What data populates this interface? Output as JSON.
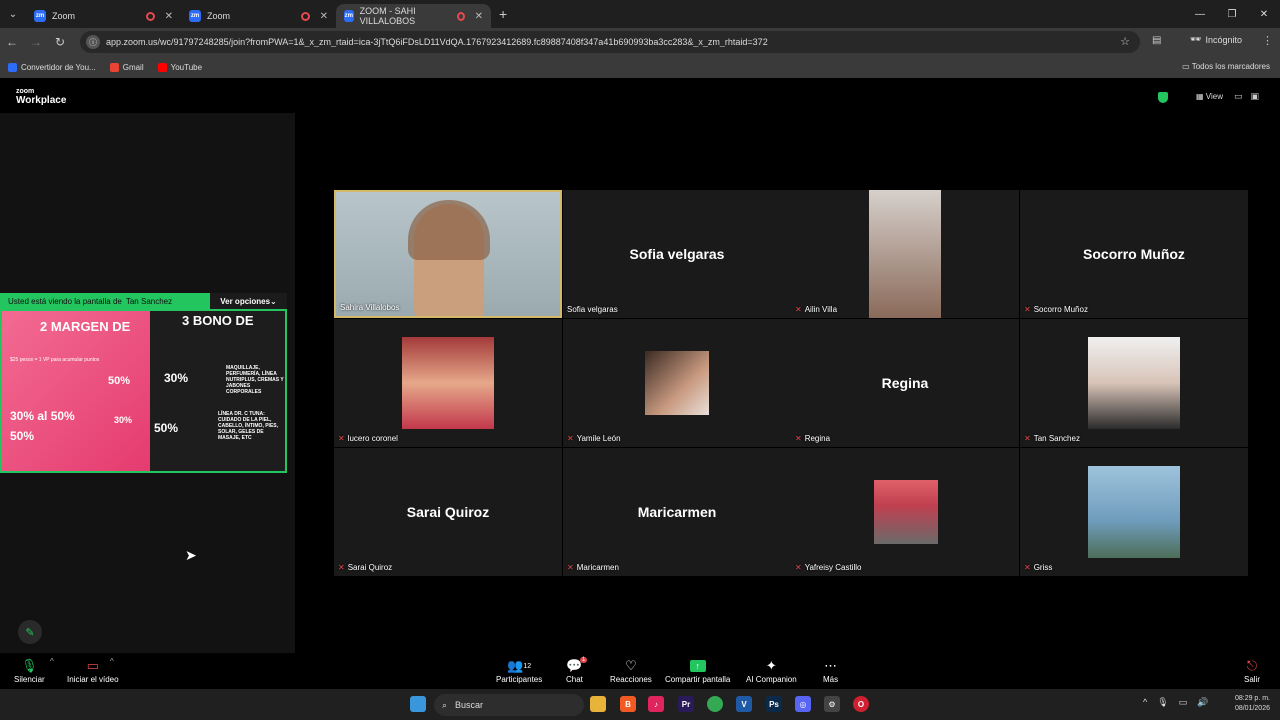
{
  "browser": {
    "tabs": [
      {
        "title": "Zoom",
        "recording": true
      },
      {
        "title": "Zoom",
        "recording": true
      },
      {
        "title": "ZOOM - SAHI VILLALOBOS",
        "recording": true
      }
    ],
    "url": "app.zoom.us/wc/91797248285/join?fromPWA=1&_x_zm_rtaid=ica-3jTtQ6iFDsLD11VdQA.1767923412689.fc89887408f347a41b690993ba3cc283&_x_zm_rhtaid=372",
    "incognito_label": "Incógnito",
    "bookmarks": [
      "Convertidor de You...",
      "Gmail",
      "YouTube"
    ],
    "all_bookmarks": "Todos los marcadores"
  },
  "zoom": {
    "logo_top": "zoom",
    "logo_bottom": "Workplace",
    "view_label": "View"
  },
  "share": {
    "viewing_text": "Usted está viendo la pantalla de",
    "presenter": "Tan Sanchez",
    "options_label": "Ver opciones",
    "slide_title_left": "2 MARGEN DE",
    "slide_title_right": "3 BONO DE",
    "slide_line": "$25 pesos = 1 VP para acumular puntos",
    "pct_a": "30%",
    "pct_b": "50%",
    "pct_range": "30% al 50%",
    "pct_c": "50%",
    "pct_d": "30%",
    "pct_e": "50%",
    "note_right_1": "MAQUILLAJE, PERFUMERÍA, LÍNEA NUTRIPLUS, CREMAS Y JABONES CORPORALES",
    "note_right_2": "LÍNEA DR. C TUNA: CUIDADO DE LA PIEL, CABELLO, ÍNTIMO, PIES, SOLAR, GELES DE MASAJE, ETC"
  },
  "participants": [
    {
      "name": "Sahira Villalobos",
      "display": "",
      "muted": false,
      "video": true
    },
    {
      "name": "Sofia velgaras",
      "display": "Sofia velgaras",
      "muted": false,
      "video": false
    },
    {
      "name": "Ailin Villa",
      "display": "",
      "muted": true,
      "video": true
    },
    {
      "name": "Socorro Muñoz",
      "display": "Socorro Muñoz",
      "muted": true,
      "video": false
    },
    {
      "name": "lucero coronel",
      "display": "",
      "muted": true,
      "video": true
    },
    {
      "name": "Yamile León",
      "display": "",
      "muted": true,
      "video": true
    },
    {
      "name": "Regina",
      "display": "Regina",
      "muted": true,
      "video": false
    },
    {
      "name": "Tan Sanchez",
      "display": "",
      "muted": true,
      "video": true
    },
    {
      "name": "Sarai Quiroz",
      "display": "Sarai Quiroz",
      "muted": true,
      "video": false
    },
    {
      "name": "Maricarmen",
      "display": "Maricarmen",
      "muted": true,
      "video": false
    },
    {
      "name": "Yafreisy Castillo",
      "display": "",
      "muted": true,
      "video": true
    },
    {
      "name": "Griss",
      "display": "",
      "muted": true,
      "video": true
    }
  ],
  "toolbar": {
    "mute": "Silenciar",
    "video": "Iniciar el vídeo",
    "participants": "Participantes",
    "participants_count": "12",
    "chat": "Chat",
    "chat_badge": "1",
    "reactions": "Reacciones",
    "share": "Compartir pantalla",
    "ai": "AI Companion",
    "more": "Más",
    "leave": "Salir"
  },
  "taskbar": {
    "search": "Buscar",
    "time": "08:29 p. m.",
    "date": "08/01/2026"
  },
  "colors": {
    "accent_green": "#22c55e",
    "mute_red": "#e5484d",
    "active_speaker": "#d4b96a"
  }
}
